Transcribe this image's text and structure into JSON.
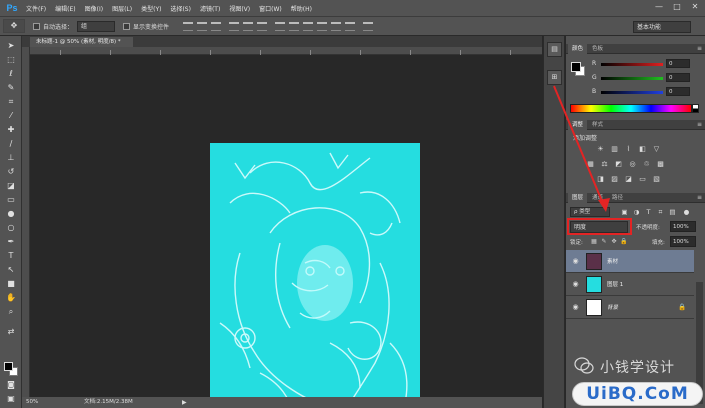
{
  "app": {
    "logo": "Ps"
  },
  "menubar": {
    "items": [
      "文件(F)",
      "编辑(E)",
      "图像(I)",
      "图层(L)",
      "类型(Y)",
      "选择(S)",
      "滤镜(T)",
      "视图(V)",
      "窗口(W)",
      "帮助(H)"
    ],
    "window_controls": [
      "—",
      "□",
      "✕"
    ]
  },
  "options_bar": {
    "tool_icon": "move-tool-icon",
    "auto_select_label": "自动选择：",
    "auto_select_value": "组",
    "show_transform_label": "显示变换控件",
    "workspace": "基本功能"
  },
  "document": {
    "tab_title": "未标题-1 @ 50% (素材, 明度/8) *"
  },
  "status": {
    "zoom": "50%",
    "doc_info": "文档:2.15M/2.38M",
    "arrow": "▶"
  },
  "panels": {
    "color": {
      "tabs": [
        "颜色",
        "色板"
      ],
      "sliders": [
        {
          "label": "R",
          "value": "0",
          "color": "#e02020"
        },
        {
          "label": "G",
          "value": "0",
          "color": "#20c020"
        },
        {
          "label": "B",
          "value": "0",
          "color": "#2040e0"
        }
      ]
    },
    "adjustments": {
      "tabs": [
        "调整",
        "样式"
      ],
      "title": "添加调整",
      "icons": [
        "brightness-icon",
        "levels-icon",
        "curves-icon",
        "exposure-icon",
        "vibrance-icon",
        "hue-saturation-icon",
        "color-balance-icon",
        "black-white-icon",
        "photo-filter-icon",
        "channel-mixer-icon",
        "color-lookup-icon",
        "invert-icon",
        "posterize-icon",
        "threshold-icon",
        "gradient-map-icon",
        "selective-color-icon"
      ]
    },
    "layers": {
      "tabs": [
        "图层",
        "通道",
        "路径"
      ],
      "filter_label": "ρ 类型",
      "blend_mode": "明度",
      "opacity_label": "不透明度:",
      "opacity_value": "100%",
      "lock_label": "锁定:",
      "fill_label": "填充:",
      "fill_value": "100%",
      "items": [
        {
          "name": "素材",
          "selected": true,
          "thumb": "#5a3048"
        },
        {
          "name": "图层 1",
          "selected": false,
          "thumb": "#25dde0"
        },
        {
          "name": "背景",
          "selected": false,
          "thumb": "#ffffff",
          "locked": true
        }
      ]
    }
  },
  "watermark": {
    "text": "小钱学设计",
    "logo": "UiBQ.CoM"
  },
  "colors": {
    "canvas_fill": "#25dde0",
    "highlight": "#e32424",
    "ps_blue": "#31a8ff"
  }
}
